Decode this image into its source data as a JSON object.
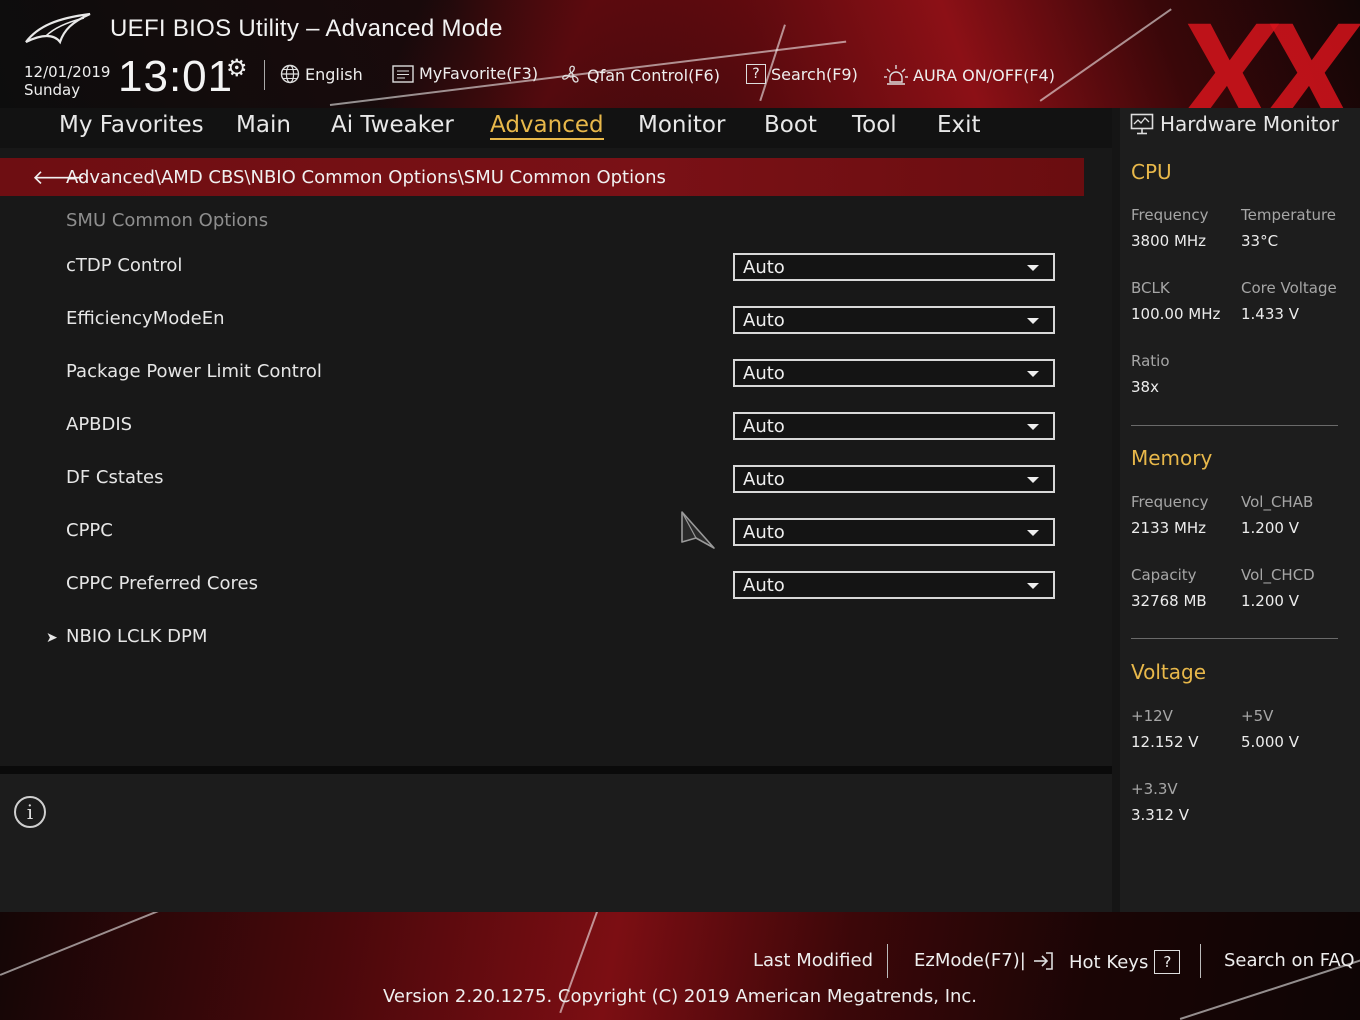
{
  "header": {
    "title": "UEFI BIOS Utility – Advanced Mode",
    "date": "12/01/2019",
    "weekday": "Sunday",
    "time": "13:01",
    "tools": {
      "language": "English",
      "myfavorite": "MyFavorite(F3)",
      "qfan": "Qfan Control(F6)",
      "search": "Search(F9)",
      "aura": "AURA ON/OFF(F4)"
    }
  },
  "nav": {
    "tabs": [
      "My Favorites",
      "Main",
      "Ai Tweaker",
      "Advanced",
      "Monitor",
      "Boot",
      "Tool",
      "Exit"
    ],
    "active": "Advanced"
  },
  "breadcrumb": "Advanced\\AMD CBS\\NBIO Common Options\\SMU Common Options",
  "section_title": "SMU Common Options",
  "settings": [
    {
      "label": "cTDP Control",
      "value": "Auto"
    },
    {
      "label": "EfficiencyModeEn",
      "value": "Auto"
    },
    {
      "label": "Package Power Limit Control",
      "value": "Auto"
    },
    {
      "label": "APBDIS",
      "value": "Auto"
    },
    {
      "label": "DF Cstates",
      "value": "Auto"
    },
    {
      "label": "CPPC",
      "value": "Auto"
    },
    {
      "label": "CPPC Preferred Cores",
      "value": "Auto"
    }
  ],
  "submenu": "NBIO LCLK DPM",
  "info_icon_glyph": "i",
  "hw_monitor": {
    "title": "Hardware Monitor",
    "cpu": {
      "heading": "CPU",
      "frequency_label": "Frequency",
      "frequency": "3800 MHz",
      "temperature_label": "Temperature",
      "temperature": "33°C",
      "bclk_label": "BCLK",
      "bclk": "100.00 MHz",
      "core_voltage_label": "Core Voltage",
      "core_voltage": "1.433 V",
      "ratio_label": "Ratio",
      "ratio": "38x"
    },
    "memory": {
      "heading": "Memory",
      "frequency_label": "Frequency",
      "frequency": "2133 MHz",
      "vol_chab_label": "Vol_CHAB",
      "vol_chab": "1.200 V",
      "capacity_label": "Capacity",
      "capacity": "32768 MB",
      "vol_chcd_label": "Vol_CHCD",
      "vol_chcd": "1.200 V"
    },
    "voltage": {
      "heading": "Voltage",
      "v12_label": "+12V",
      "v12": "12.152 V",
      "v5_label": "+5V",
      "v5": "5.000 V",
      "v33_label": "+3.3V",
      "v33": "3.312 V"
    }
  },
  "footer": {
    "last_modified": "Last Modified",
    "ezmode": "EzMode(F7)|",
    "hotkeys": "Hot Keys",
    "hotkeys_key": "?",
    "faq": "Search on FAQ",
    "version": "Version 2.20.1275. Copyright (C) 2019 American Megatrends, Inc."
  },
  "watermark": "XX",
  "colors": {
    "accent": "#e8b84a",
    "breadcrumb_bg": "#7a1116",
    "brand_red": "#d7141c"
  }
}
